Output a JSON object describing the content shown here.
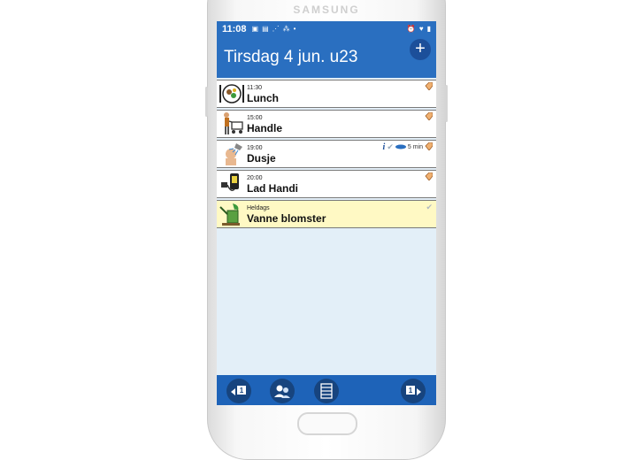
{
  "phone": {
    "brand": "SAMSUNG"
  },
  "status_bar": {
    "time": "11:08"
  },
  "header": {
    "title": "Tirsdag 4 jun. u23",
    "add_label": "+"
  },
  "activities": [
    {
      "time": "11:30",
      "title": "Lunch",
      "icon": "plate-icon"
    },
    {
      "time": "15:00",
      "title": "Handle",
      "icon": "shopping-cart-icon"
    },
    {
      "time": "19:00",
      "title": "Dusje",
      "icon": "shower-icon",
      "reminder": "5 min"
    },
    {
      "time": "20:00",
      "title": "Lad Handi",
      "icon": "phone-charger-icon"
    },
    {
      "time": "Heldags",
      "title": "Vanne blomster",
      "icon": "watering-can-icon",
      "all_day": true
    }
  ],
  "bottom_nav": {
    "prev_day_number": "1",
    "next_day_number": "1"
  },
  "colors": {
    "header": "#2a6fc0",
    "screen_background": "#e3eff8",
    "all_day_row": "#fff9c4",
    "bottom_bar": "#1e63b8"
  }
}
